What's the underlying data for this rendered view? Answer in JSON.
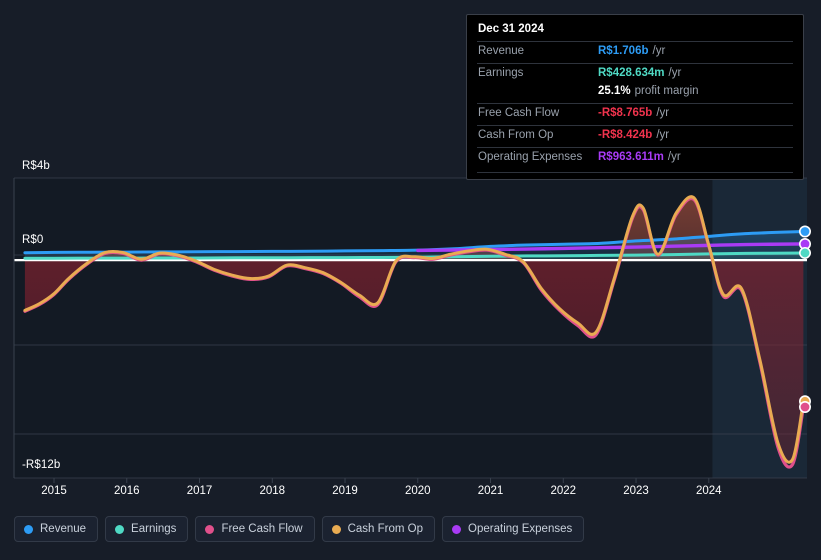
{
  "background_color": "#171d28",
  "tooltip": {
    "date": "Dec 31 2024",
    "rows": [
      {
        "key": "Revenue",
        "value": "R$1.706b",
        "unit": "/yr",
        "color": "#2d9cf5"
      },
      {
        "key": "Earnings",
        "value": "R$428.634m",
        "unit": "/yr",
        "color": "#4fd9c4"
      },
      {
        "key": "Free Cash Flow",
        "value": "-R$8.765b",
        "unit": "/yr",
        "color": "#f0334d"
      },
      {
        "key": "Cash From Op",
        "value": "-R$8.424b",
        "unit": "/yr",
        "color": "#f0334d"
      },
      {
        "key": "Operating Expenses",
        "value": "R$963.611m",
        "unit": "/yr",
        "color": "#a93bf5"
      }
    ],
    "margin": {
      "value": "25.1%",
      "label": "profit margin"
    }
  },
  "legend": {
    "items": [
      {
        "label": "Revenue",
        "color": "#2d9cf5"
      },
      {
        "label": "Earnings",
        "color": "#4fd9c4"
      },
      {
        "label": "Free Cash Flow",
        "color": "#e0508b"
      },
      {
        "label": "Cash From Op",
        "color": "#e9ab52"
      },
      {
        "label": "Operating Expenses",
        "color": "#a93bf5"
      }
    ]
  },
  "axes": {
    "y_top_label": "R$4b",
    "y_zero_label": "R$0",
    "y_bottom_label": "-R$12b",
    "x_labels": [
      "2015",
      "2016",
      "2017",
      "2018",
      "2019",
      "2020",
      "2021",
      "2022",
      "2023",
      "2024"
    ]
  },
  "chart_data": {
    "type": "line",
    "title": "",
    "xlabel": "",
    "ylabel": "R$",
    "currency": "BRL",
    "units": "billions",
    "ylim": [
      -13.0,
      4.9
    ],
    "xlim": [
      2014.45,
      2025.35
    ],
    "grid": true,
    "zero_line": true,
    "legend_position": "bottom-left",
    "forecast_region": {
      "from": 2024.05,
      "to": 2025.35,
      "shaded": true
    },
    "y_ticks": [
      {
        "value": 4,
        "label": "R$4b"
      },
      {
        "value": 0,
        "label": "R$0"
      },
      {
        "value": -12,
        "label": "-R$12b"
      }
    ],
    "x_ticks": [
      2015,
      2016,
      2017,
      2018,
      2019,
      2020,
      2021,
      2022,
      2023,
      2024
    ],
    "series": [
      {
        "name": "Revenue",
        "color": "#2d9cf5",
        "area": true,
        "x": [
          2014.6,
          2015.0,
          2015.5,
          2016.0,
          2016.5,
          2017.0,
          2017.5,
          2018.0,
          2018.5,
          2019.0,
          2019.5,
          2020.0,
          2020.5,
          2021.0,
          2021.5,
          2022.0,
          2022.5,
          2023.0,
          2023.5,
          2024.0,
          2024.5,
          2025.3
        ],
        "values": [
          0.44,
          0.46,
          0.47,
          0.48,
          0.49,
          0.5,
          0.51,
          0.52,
          0.53,
          0.55,
          0.57,
          0.6,
          0.68,
          0.82,
          0.9,
          0.95,
          1.0,
          1.15,
          1.25,
          1.42,
          1.58,
          1.706
        ]
      },
      {
        "name": "Earnings",
        "color": "#4fd9c4",
        "area": true,
        "x": [
          2014.6,
          2015.0,
          2015.5,
          2016.0,
          2016.5,
          2017.0,
          2017.5,
          2018.0,
          2018.5,
          2019.0,
          2019.5,
          2020.0,
          2020.5,
          2021.0,
          2021.5,
          2022.0,
          2022.5,
          2023.0,
          2023.5,
          2024.0,
          2024.5,
          2025.3
        ],
        "values": [
          0.11,
          0.11,
          0.12,
          0.12,
          0.13,
          0.13,
          0.14,
          0.14,
          0.15,
          0.15,
          0.16,
          0.17,
          0.2,
          0.23,
          0.25,
          0.26,
          0.28,
          0.3,
          0.33,
          0.37,
          0.4,
          0.4286
        ]
      },
      {
        "name": "Operating Expenses",
        "color": "#a93bf5",
        "area": false,
        "x": [
          2020.0,
          2020.5,
          2021.0,
          2021.5,
          2022.0,
          2022.5,
          2023.0,
          2023.5,
          2024.0,
          2024.5,
          2025.3
        ],
        "values": [
          0.58,
          0.6,
          0.63,
          0.66,
          0.7,
          0.74,
          0.78,
          0.83,
          0.88,
          0.93,
          0.9636
        ]
      },
      {
        "name": "Cash From Op",
        "color": "#e9ab52",
        "area": true,
        "x": [
          2014.6,
          2014.8,
          2015.0,
          2015.2,
          2015.45,
          2015.7,
          2015.95,
          2016.2,
          2016.45,
          2016.7,
          2016.95,
          2017.2,
          2017.45,
          2017.7,
          2017.95,
          2018.2,
          2018.45,
          2018.7,
          2018.95,
          2019.2,
          2019.45,
          2019.7,
          2019.95,
          2020.2,
          2020.45,
          2020.7,
          2020.95,
          2021.2,
          2021.45,
          2021.7,
          2021.95,
          2022.2,
          2022.45,
          2022.7,
          2022.95,
          2023.1,
          2023.3,
          2023.55,
          2023.8,
          2024.0,
          2024.2,
          2024.45,
          2024.7,
          2024.95,
          2025.15,
          2025.3
        ],
        "values": [
          -3.0,
          -2.6,
          -2.0,
          -1.1,
          -0.2,
          0.45,
          0.45,
          0.05,
          0.42,
          0.3,
          -0.05,
          -0.55,
          -0.9,
          -1.1,
          -0.95,
          -0.3,
          -0.45,
          -0.75,
          -1.35,
          -2.1,
          -2.55,
          -0.05,
          0.2,
          0.1,
          0.35,
          0.55,
          0.65,
          0.35,
          -0.1,
          -1.7,
          -2.9,
          -3.75,
          -4.3,
          -1.1,
          2.6,
          3.1,
          0.35,
          2.8,
          3.7,
          0.9,
          -2.05,
          -1.7,
          -5.9,
          -10.9,
          -11.9,
          -8.424
        ]
      },
      {
        "name": "Free Cash Flow",
        "color": "#e0508b",
        "area": true,
        "x": [
          2014.6,
          2014.8,
          2015.0,
          2015.2,
          2015.45,
          2015.7,
          2015.95,
          2016.2,
          2016.45,
          2016.7,
          2016.95,
          2017.2,
          2017.45,
          2017.7,
          2017.95,
          2018.2,
          2018.45,
          2018.7,
          2018.95,
          2019.2,
          2019.45,
          2019.7,
          2019.95,
          2020.2,
          2020.45,
          2020.7,
          2020.95,
          2021.2,
          2021.45,
          2021.7,
          2021.95,
          2022.2,
          2022.45,
          2022.7,
          2022.95,
          2023.1,
          2023.3,
          2023.55,
          2023.8,
          2024.0,
          2024.2,
          2024.45,
          2024.7,
          2024.95,
          2025.15,
          2025.3
        ],
        "values": [
          -3.05,
          -2.65,
          -2.05,
          -1.15,
          -0.25,
          0.4,
          0.4,
          0.0,
          0.38,
          0.26,
          -0.1,
          -0.6,
          -0.95,
          -1.15,
          -1.0,
          -0.35,
          -0.5,
          -0.8,
          -1.4,
          -2.2,
          -2.65,
          -0.1,
          0.15,
          0.05,
          0.3,
          0.5,
          0.6,
          0.3,
          -0.15,
          -1.8,
          -3.0,
          -3.9,
          -4.45,
          -1.2,
          2.5,
          3.0,
          0.3,
          2.7,
          3.6,
          0.85,
          -2.15,
          -1.8,
          -6.05,
          -11.15,
          -12.2,
          -8.765
        ]
      }
    ],
    "end_markers": [
      {
        "name": "Revenue",
        "value": 1.706,
        "color": "#2d9cf5"
      },
      {
        "name": "Operating Expenses",
        "value": 0.9636,
        "color": "#a93bf5"
      },
      {
        "name": "Earnings",
        "value": 0.4286,
        "color": "#4fd9c4"
      },
      {
        "name": "Cash From Op",
        "value": -8.424,
        "color": "#e9ab52"
      },
      {
        "name": "Free Cash Flow",
        "value": -8.765,
        "color": "#e0508b"
      }
    ]
  }
}
